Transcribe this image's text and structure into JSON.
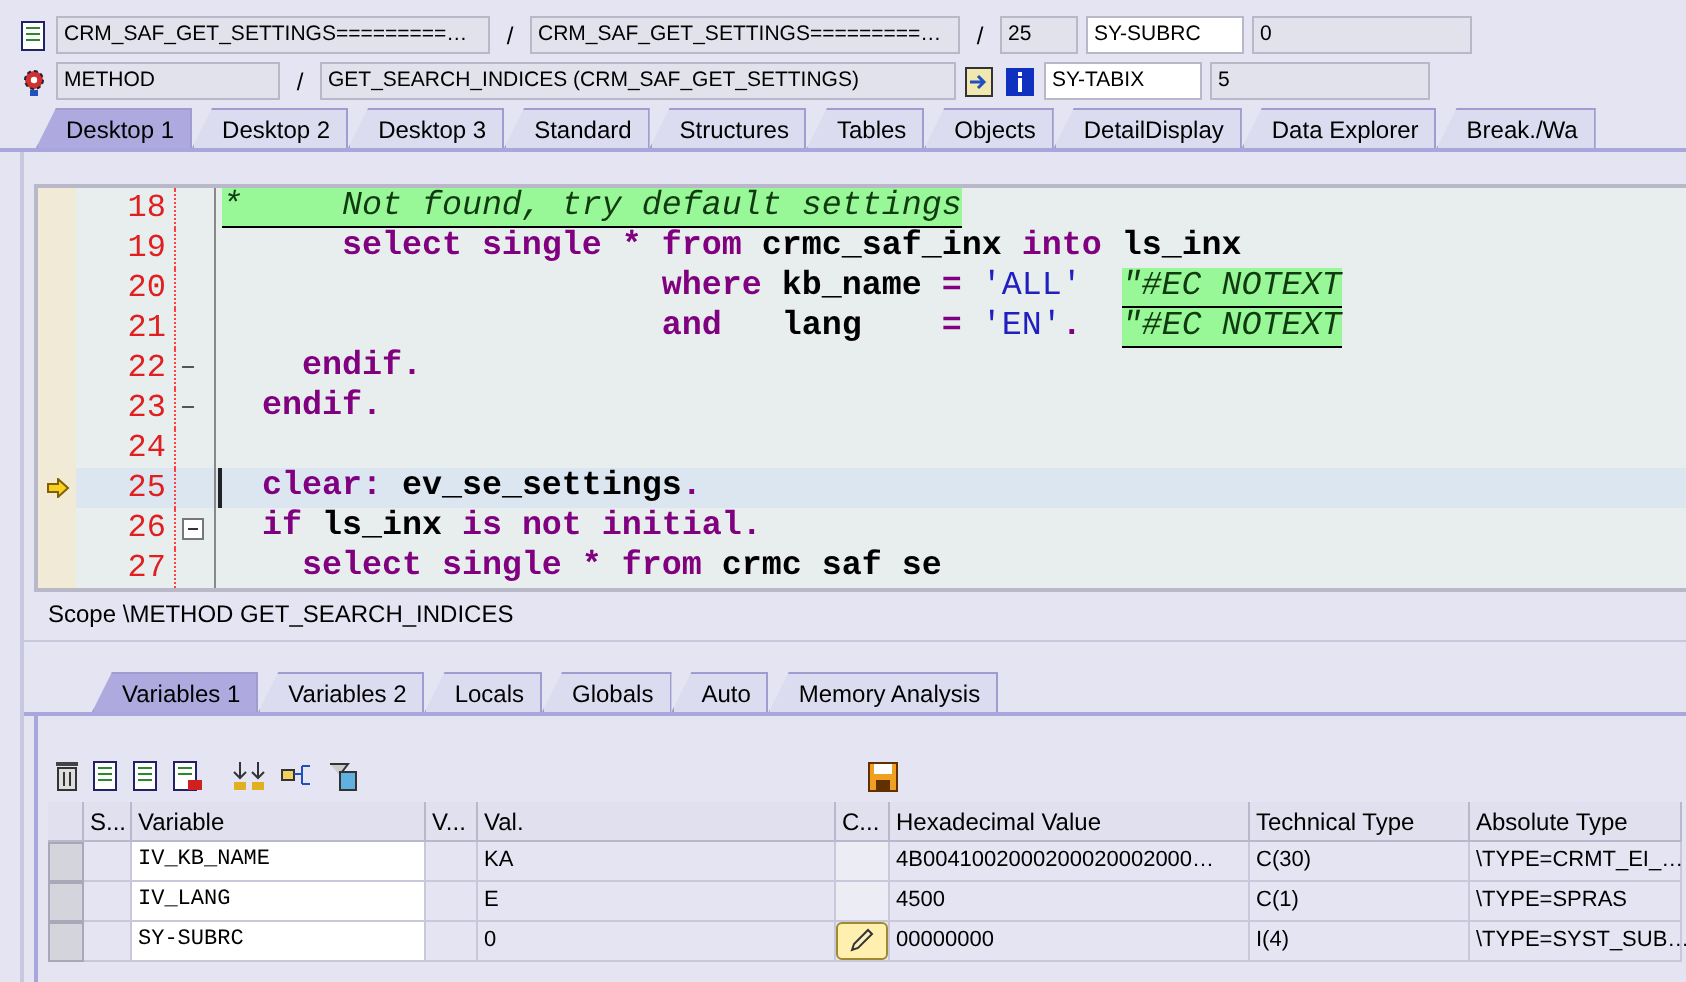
{
  "header": {
    "row1": {
      "program": "CRM_SAF_GET_SETTINGS=========…",
      "separators": [
        "/",
        "/"
      ],
      "include": "CRM_SAF_GET_SETTINGS=========…",
      "line": "25",
      "field_name": "SY-SUBRC",
      "field_value": "0"
    },
    "row2": {
      "event_type": "METHOD",
      "separators": [
        "/"
      ],
      "event": "GET_SEARCH_INDICES (CRM_SAF_GET_SETTINGS)",
      "field_name": "SY-TABIX",
      "field_value": "5"
    }
  },
  "desktop_tabs": [
    {
      "label": "Desktop 1",
      "selected": true
    },
    {
      "label": "Desktop 2",
      "selected": false
    },
    {
      "label": "Desktop 3",
      "selected": false
    },
    {
      "label": "Standard",
      "selected": false
    },
    {
      "label": "Structures",
      "selected": false
    },
    {
      "label": "Tables",
      "selected": false
    },
    {
      "label": "Objects",
      "selected": false
    },
    {
      "label": "DetailDisplay",
      "selected": false
    },
    {
      "label": "Data Explorer",
      "selected": false
    },
    {
      "label": "Break./Wa",
      "selected": false
    }
  ],
  "code": [
    {
      "number": "18",
      "current": false,
      "block_end": false,
      "block_start": false,
      "tokens": [
        {
          "kind": "comment",
          "text": "*     Not found, try default settings"
        }
      ]
    },
    {
      "number": "19",
      "current": false,
      "block_end": false,
      "block_start": false,
      "tokens": [
        {
          "kind": "keyword",
          "text": "      select single * from "
        },
        {
          "kind": "ident",
          "text": "crmc_saf_inx "
        },
        {
          "kind": "keyword",
          "text": "into "
        },
        {
          "kind": "ident",
          "text": "ls_inx"
        }
      ]
    },
    {
      "number": "20",
      "current": false,
      "block_end": false,
      "block_start": false,
      "tokens": [
        {
          "kind": "keyword",
          "text": "                      where "
        },
        {
          "kind": "ident",
          "text": "kb_name "
        },
        {
          "kind": "keyword",
          "text": "= "
        },
        {
          "kind": "string",
          "text": "'ALL'  "
        },
        {
          "kind": "comment",
          "text": "\"#EC NOTEXT"
        }
      ]
    },
    {
      "number": "21",
      "current": false,
      "block_end": false,
      "block_start": false,
      "tokens": [
        {
          "kind": "keyword",
          "text": "                      and   "
        },
        {
          "kind": "ident",
          "text": "lang    "
        },
        {
          "kind": "keyword",
          "text": "= "
        },
        {
          "kind": "string",
          "text": "'EN'"
        },
        {
          "kind": "keyword",
          "text": ".  "
        },
        {
          "kind": "comment",
          "text": "\"#EC NOTEXT"
        }
      ]
    },
    {
      "number": "22",
      "current": false,
      "block_end": true,
      "block_start": false,
      "tokens": [
        {
          "kind": "keyword",
          "text": "    endif."
        }
      ]
    },
    {
      "number": "23",
      "current": false,
      "block_end": true,
      "block_start": false,
      "tokens": [
        {
          "kind": "keyword",
          "text": "  endif."
        }
      ]
    },
    {
      "number": "24",
      "current": false,
      "block_end": false,
      "block_start": false
    },
    {
      "number": "25",
      "current": true,
      "block_end": false,
      "block_start": false,
      "tokens": [
        {
          "kind": "keyword",
          "text": "  clear: "
        },
        {
          "kind": "ident",
          "text": "ev_se_settings"
        },
        {
          "kind": "keyword",
          "text": "."
        }
      ]
    },
    {
      "number": "26",
      "current": false,
      "block_end": false,
      "block_start": true,
      "tokens": [
        {
          "kind": "keyword",
          "text": "  if "
        },
        {
          "kind": "ident",
          "text": "ls_inx "
        },
        {
          "kind": "keyword",
          "text": "is not initial."
        }
      ]
    },
    {
      "number": "27",
      "current": false,
      "block_end": false,
      "block_start": false,
      "tokens": [
        {
          "kind": "keyword",
          "text": "    select single * from "
        },
        {
          "kind": "ident",
          "text": "crmc saf se"
        }
      ]
    }
  ],
  "scope": "Scope \\METHOD GET_SEARCH_INDICES",
  "variable_tabs": [
    {
      "label": "Variables 1",
      "selected": true
    },
    {
      "label": "Variables 2",
      "selected": false
    },
    {
      "label": "Locals",
      "selected": false
    },
    {
      "label": "Globals",
      "selected": false
    },
    {
      "label": "Auto",
      "selected": false
    },
    {
      "label": "Memory Analysis",
      "selected": false
    }
  ],
  "table": {
    "columns": [
      "S...",
      "Variable",
      "V...",
      "Val.",
      "C...",
      "Hexadecimal Value",
      "Technical Type",
      "Absolute Type"
    ],
    "rows": [
      {
        "variable": "IV_KB_NAME",
        "value": "KA",
        "change_button": false,
        "hex": "4B0041002000200020002000…",
        "technical_type": "C(30)",
        "absolute_type": "\\TYPE=CRMT_EI_…"
      },
      {
        "variable": "IV_LANG",
        "value": "E",
        "change_button": false,
        "hex": "4500",
        "technical_type": "C(1)",
        "absolute_type": "\\TYPE=SPRAS"
      },
      {
        "variable": "SY-SUBRC",
        "value": "0",
        "change_button": true,
        "hex": "00000000",
        "technical_type": "I(4)",
        "absolute_type": "\\TYPE=SYST_SUB…"
      }
    ]
  }
}
